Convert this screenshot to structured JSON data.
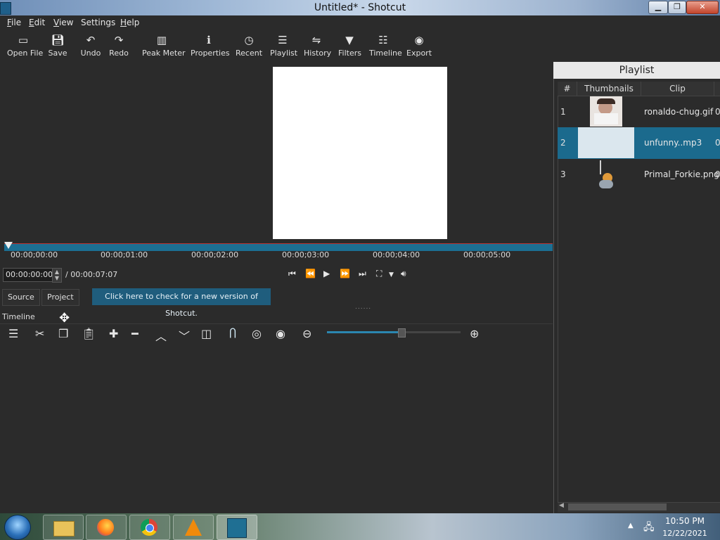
{
  "window": {
    "title": "Untitled* - Shotcut"
  },
  "menu": [
    {
      "label": "File",
      "mnemonic": "F",
      "rest": "ile"
    },
    {
      "label": "Edit",
      "mnemonic": "E",
      "rest": "dit"
    },
    {
      "label": "View",
      "mnemonic": "V",
      "rest": "iew"
    },
    {
      "label": "Settings",
      "mnemonic": "",
      "rest": "Settings"
    },
    {
      "label": "Help",
      "mnemonic": "H",
      "rest": "elp"
    }
  ],
  "toolbar": {
    "open_file": "Open File",
    "save": "Save",
    "undo": "Undo",
    "redo": "Redo",
    "peak_meter": "Peak Meter",
    "properties": "Properties",
    "recent": "Recent",
    "playlist": "Playlist",
    "history": "History",
    "filters": "Filters",
    "timeline": "Timeline",
    "export": "Export"
  },
  "ruler": {
    "ticks": [
      "00:00;00:00",
      "00:00;01:00",
      "00:00;02:00",
      "00:00;03:00",
      "00:00;04:00",
      "00:00;05:00"
    ]
  },
  "transport": {
    "position": "00:00:00:00",
    "duration": "/ 00:00:07:07"
  },
  "tabs": {
    "source": "Source",
    "project": "Project"
  },
  "notice": "Click here to check for a new version of Shotcut.",
  "timeline": {
    "label": "Timeline"
  },
  "playlist": {
    "title": "Playlist",
    "columns": [
      "#",
      "Thumbnails",
      "Clip"
    ],
    "rows": [
      {
        "num": "1",
        "clip": "ronaldo-chug.gif",
        "extra": "0"
      },
      {
        "num": "2",
        "clip": "unfunny..mp3",
        "extra": "0"
      },
      {
        "num": "3",
        "clip": "Primal_Forkie.png",
        "extra": "0"
      }
    ],
    "selected_row": 2
  },
  "taskbar": {
    "time": "10:50 PM",
    "date": "12/22/2021"
  },
  "colors": {
    "accent": "#1b6a8d",
    "background": "#2b2b2b"
  }
}
